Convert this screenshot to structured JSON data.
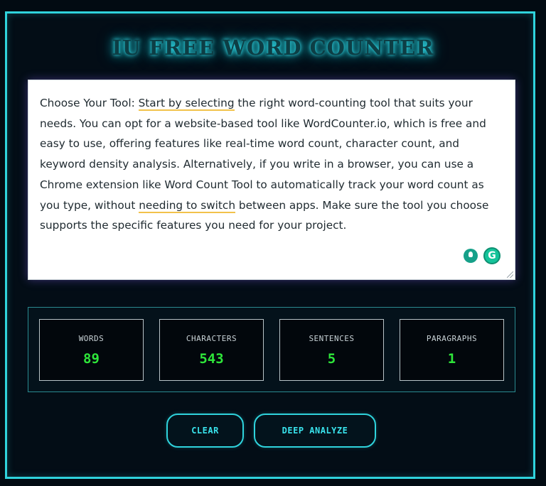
{
  "app": {
    "title": "IU FREE WORD COUNTER"
  },
  "editor": {
    "text_segments": [
      "Choose Your Tool: ",
      "Start by selecting",
      " the right word-counting tool that suits your needs. You can opt for a website-based tool like WordCounter.io, which is free and easy to use, offering features like real-time word count, character count, and keyword density analysis. Alternatively, if you write in a browser, you can use a Chrome extension like Word Count Tool to automatically track your word count as you type, without ",
      "needing to switch",
      " between apps. Make sure the tool you choose supports the specific features you need for your project."
    ],
    "grammar_badge": "G",
    "underline_color": "#f2c24b"
  },
  "stats": {
    "words": {
      "label": "WORDS",
      "value": "89"
    },
    "characters": {
      "label": "CHARACTERS",
      "value": "543"
    },
    "sentences": {
      "label": "SENTENCES",
      "value": "5"
    },
    "paragraphs": {
      "label": "PARAGRAPHS",
      "value": "1"
    }
  },
  "buttons": {
    "clear_label": "CLEAR",
    "deep_analyze_label": "DEEP ANALYZE"
  },
  "colors": {
    "accent": "#2fd3dc",
    "value_green": "#2ee63a",
    "background": "#020b12"
  }
}
